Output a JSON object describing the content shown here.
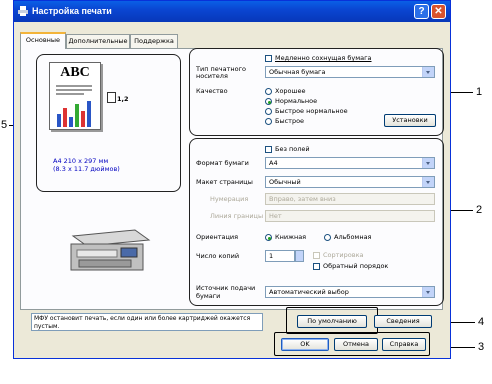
{
  "window": {
    "title": "Настройка печати"
  },
  "tabs": [
    {
      "label": "Основные"
    },
    {
      "label": "Дополнительные"
    },
    {
      "label": "Поддержка"
    }
  ],
  "preview": {
    "doc_heading": "ABC",
    "copies_label": "1,2",
    "paper_size_mm": "A4 210 x 297 мм",
    "paper_size_in": "(8.3 x 11.7 дюймов)"
  },
  "media": {
    "slow_drying_label": "Медленно сохнущая бумага",
    "media_type_label_1": "Тип печатного",
    "media_type_label_2": "носителя",
    "media_type_value": "Обычная бумага",
    "quality_label": "Качество",
    "quality_options": [
      "Хорошее",
      "Нормальное",
      "Быстрое нормальное",
      "Быстрое"
    ],
    "settings_button": "Установки"
  },
  "layout": {
    "borderless_label": "Без полей",
    "paper_size_label": "Формат бумаги",
    "paper_size_value": "A4",
    "page_layout_label": "Макет страницы",
    "page_layout_value": "Обычный",
    "page_order_label": "Нумерация",
    "page_order_value": "Вправо, затем вниз",
    "border_line_label": "Линия границы",
    "border_line_value": "Нет",
    "orientation_label": "Ориентация",
    "portrait_label": "Книжная",
    "landscape_label": "Альбомная",
    "copies_label": "Число копий",
    "copies_value": "1",
    "collate_label": "Сортировка",
    "reverse_order_label": "Обратный порядок",
    "paper_source_label_1": "Источник подачи",
    "paper_source_label_2": "бумаги",
    "paper_source_value": "Автоматический выбор"
  },
  "status_message": "МФУ остановит печать, если один или более картриджей окажется пустым.",
  "buttons": {
    "default": "По умолчанию",
    "about": "Сведения",
    "ok": "OK",
    "cancel": "Отмена",
    "help": "Справка"
  },
  "callouts": [
    "1",
    "2",
    "3",
    "4",
    "5"
  ]
}
